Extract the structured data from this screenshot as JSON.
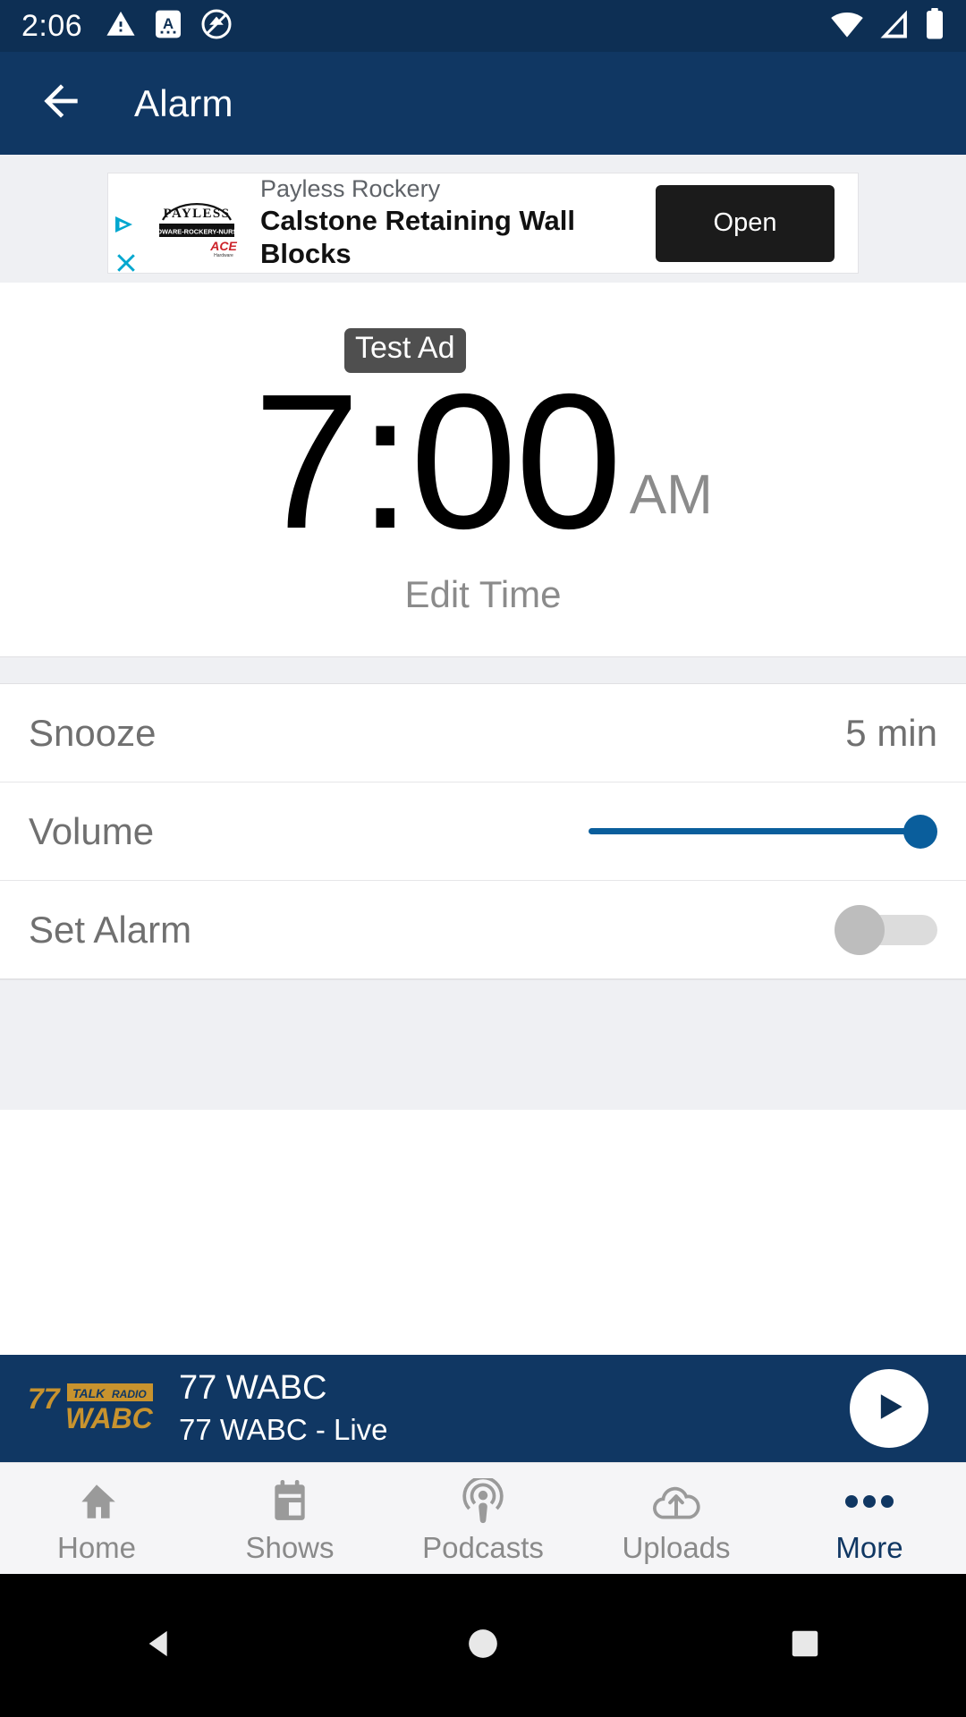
{
  "status_bar": {
    "time": "2:06",
    "left_icons": [
      "warning-triangle-icon",
      "autofill-a-icon",
      "do-not-disturb-icon"
    ],
    "right_icons": [
      "wifi-icon",
      "cellular-signal-icon",
      "battery-full-icon"
    ],
    "background_color": "#0d2f54",
    "foreground_color": "#ffffff"
  },
  "app_bar": {
    "title": "Alarm",
    "back_icon": "arrow-left-icon",
    "background_color": "#103763"
  },
  "ad": {
    "badge_label": "Test Ad",
    "advertiser": "Payless Rockery",
    "headline": "Calstone Retaining Wall Blocks",
    "cta_label": "Open",
    "logo_primary_text": "PAYLESS",
    "logo_secondary_text": "HARDWARE-ROCKERY-NURSERY",
    "logo_accent_text": "ACE",
    "adchoices_icon": "adchoices-triangle-icon",
    "close_icon": "close-x-icon",
    "cta_background_color": "#1b1b1b",
    "badge_background_color": "#4f4f4f"
  },
  "alarm": {
    "time": "7:00",
    "meridiem": "AM",
    "edit_label": "Edit Time"
  },
  "settings": {
    "rows": [
      {
        "label": "Snooze",
        "value": "5 min",
        "control": "value"
      },
      {
        "label": "Volume",
        "value": "",
        "control": "slider"
      },
      {
        "label": "Set Alarm",
        "value": "",
        "control": "toggle"
      }
    ],
    "volume_percent": 100,
    "set_alarm_on": false,
    "slider_color": "#0a5e9c",
    "toggle_off_color": "#bdbdbd"
  },
  "player": {
    "station_title": "77 WABC",
    "station_subtitle": "77 WABC - Live",
    "play_icon": "play-triangle-icon",
    "logo_number": "77",
    "logo_talk": "TALK",
    "logo_radio": "RADIO",
    "logo_call": "WABC",
    "background_color": "#103763",
    "logo_gold_color": "#c8932e"
  },
  "tab_bar": {
    "items": [
      {
        "label": "Home",
        "icon": "home-icon",
        "active": false
      },
      {
        "label": "Shows",
        "icon": "calendar-icon",
        "active": false
      },
      {
        "label": "Podcasts",
        "icon": "podcast-icon",
        "active": false
      },
      {
        "label": "Uploads",
        "icon": "upload-cloud-icon",
        "active": false
      },
      {
        "label": "More",
        "icon": "more-dots-icon",
        "active": true
      }
    ],
    "active_color": "#103763",
    "inactive_color": "#8a8a8a"
  },
  "nav_bar": {
    "buttons": [
      "back-triangle-icon",
      "home-circle-icon",
      "recents-square-icon"
    ],
    "background_color": "#000000"
  }
}
